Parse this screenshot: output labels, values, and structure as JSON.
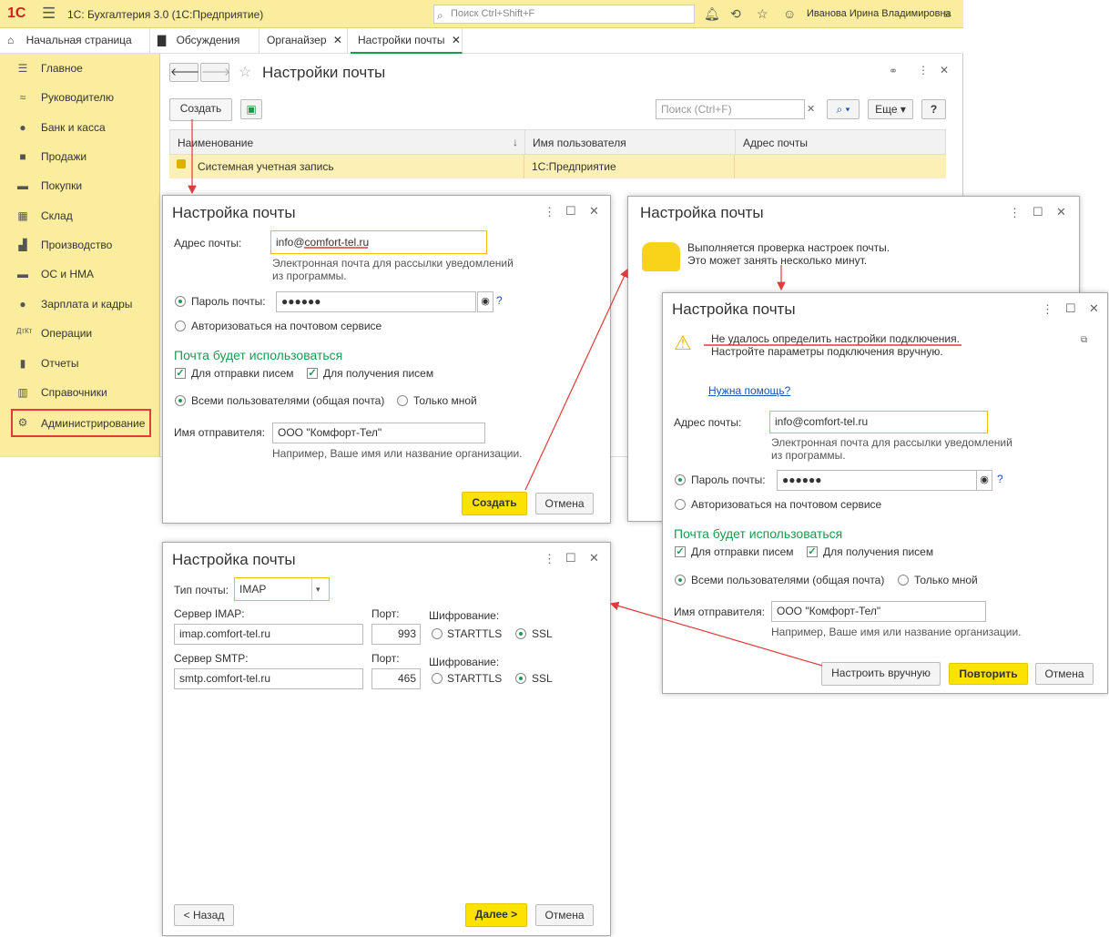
{
  "app": {
    "logo": "1С",
    "title": "1С: Бухгалтерия 3.0  (1С:Предприятие)",
    "search_placeholder": "Поиск Ctrl+Shift+F",
    "user": "Иванова Ирина Владимировна"
  },
  "tabs": [
    {
      "label": "Начальная страница"
    },
    {
      "label": "Обсуждения"
    },
    {
      "label": "Органайзер"
    },
    {
      "label": "Настройки почты"
    }
  ],
  "sidebar": {
    "items": [
      {
        "label": "Главное",
        "icon": "menu-icon"
      },
      {
        "label": "Руководителю",
        "icon": "chart-icon"
      },
      {
        "label": "Банк и касса",
        "icon": "coin-icon"
      },
      {
        "label": "Продажи",
        "icon": "bag-icon"
      },
      {
        "label": "Покупки",
        "icon": "cart-icon"
      },
      {
        "label": "Склад",
        "icon": "grid-icon"
      },
      {
        "label": "Производство",
        "icon": "factory-icon"
      },
      {
        "label": "ОС и НМА",
        "icon": "truck-icon"
      },
      {
        "label": "Зарплата и кадры",
        "icon": "person-icon"
      },
      {
        "label": "Операции",
        "icon": "dt-kt-icon"
      },
      {
        "label": "Отчеты",
        "icon": "bar-chart-icon"
      },
      {
        "label": "Справочники",
        "icon": "book-icon"
      },
      {
        "label": "Администрирование",
        "icon": "gear-icon"
      }
    ]
  },
  "main": {
    "title": "Настройки почты",
    "create": "Создать",
    "search_placeholder": "Поиск (Ctrl+F)",
    "more": "Еще",
    "help": "?",
    "columns": [
      "Наименование",
      "Имя пользователя",
      "Адрес почты"
    ],
    "rows": [
      {
        "name": "Системная учетная запись",
        "user": "1С:Предприятие",
        "email": ""
      }
    ]
  },
  "dialog1": {
    "title": "Настройка почты",
    "email_label": "Адрес почты:",
    "email": "info@comfort-tel.ru",
    "email_hint": "Электронная почта для рассылки уведомлений из программы.",
    "password_label": "Пароль почты:",
    "password": "●●●●●●",
    "auth_label": "Авторизоваться на почтовом сервисе",
    "use_header": "Почта будет использоваться",
    "send": "Для отправки писем",
    "receive": "Для получения писем",
    "all_users": "Всеми пользователями (общая почта)",
    "only_me": "Только мной",
    "sender_label": "Имя отправителя:",
    "sender": "ООО \"Комфорт-Тел\"",
    "sender_hint": "Например, Ваше имя или название организации.",
    "create": "Создать",
    "cancel": "Отмена",
    "help": "?"
  },
  "dialog2": {
    "title": "Настройка почты",
    "line1": "Выполняется проверка настроек почты.",
    "line2": "Это может занять несколько минут."
  },
  "dialog3": {
    "title": "Настройка почты",
    "error1": "Не удалось определить настройки подключения.",
    "error2": "Настройте параметры подключения вручную.",
    "help_link": "Нужна помощь?",
    "email_label": "Адрес почты:",
    "email": "info@comfort-tel.ru",
    "email_hint": "Электронная почта для рассылки уведомлений из программы.",
    "password_label": "Пароль почты:",
    "password": "●●●●●●",
    "auth_label": "Авторизоваться на почтовом сервисе",
    "use_header": "Почта будет использоваться",
    "send": "Для отправки писем",
    "receive": "Для получения писем",
    "all_users": "Всеми пользователями (общая почта)",
    "only_me": "Только мной",
    "sender_label": "Имя отправителя:",
    "sender": "ООО \"Комфорт-Тел\"",
    "sender_hint": "Например, Ваше имя или название организации.",
    "manual": "Настроить вручную",
    "retry": "Повторить",
    "cancel": "Отмена",
    "help": "?"
  },
  "dialog4": {
    "title": "Настройка почты",
    "type_label": "Тип почты:",
    "type": "IMAP",
    "imap_label": "Сервер IMAP:",
    "imap": "imap.comfort-tel.ru",
    "smtp_label": "Сервер SMTP:",
    "smtp": "smtp.comfort-tel.ru",
    "port_label": "Порт:",
    "imap_port": "993",
    "smtp_port": "465",
    "enc_label": "Шифрование:",
    "starttls": "STARTTLS",
    "ssl": "SSL",
    "back": "< Назад",
    "next": "Далее >",
    "cancel": "Отмена"
  },
  "colors": {
    "accent_yellow": "#fbed9e",
    "button_yellow": "#fbe200",
    "green": "#1b9a4f",
    "red": "#e03a3a"
  }
}
